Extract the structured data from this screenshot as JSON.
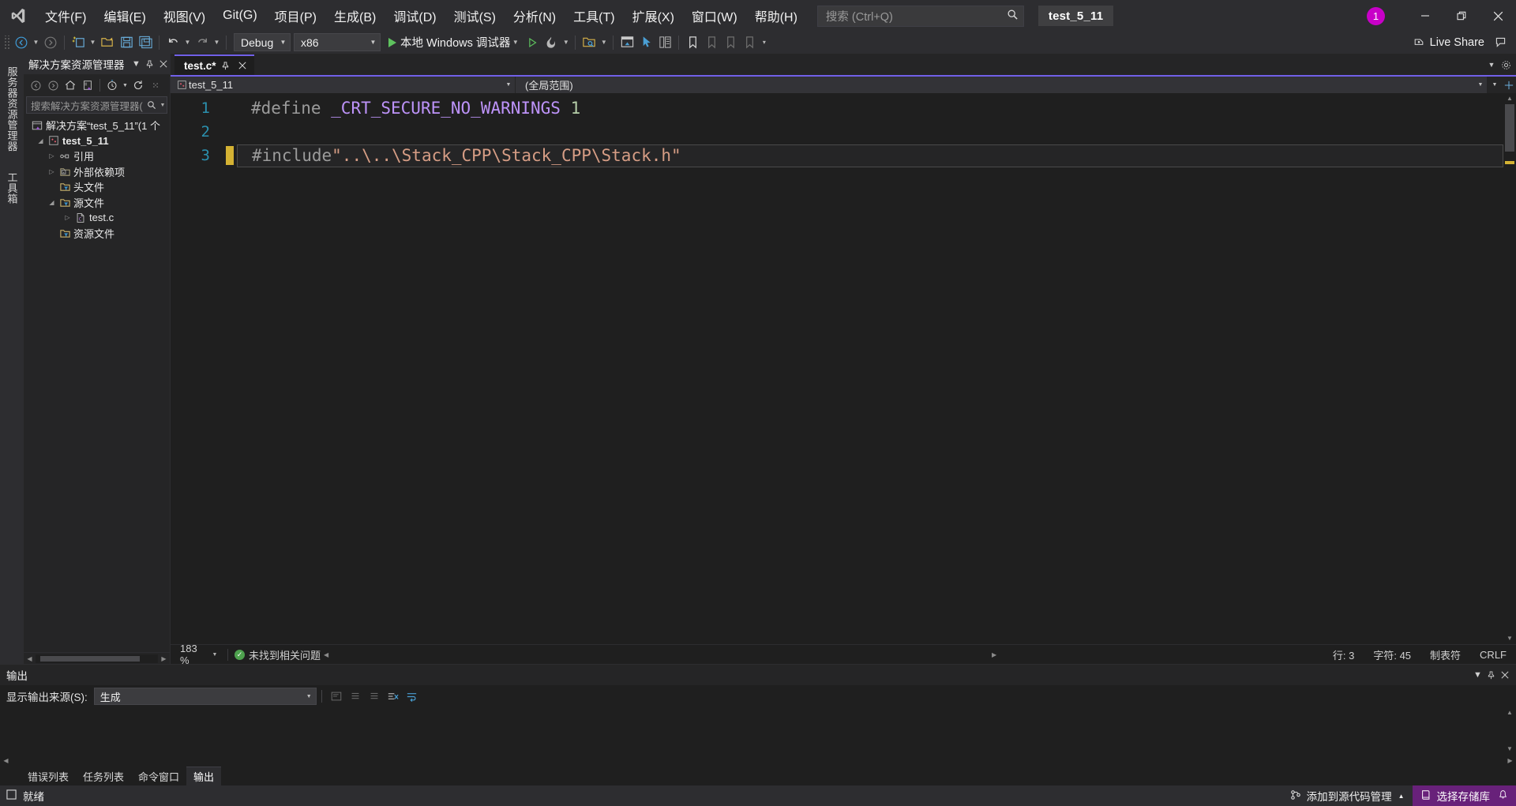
{
  "titlebar": {
    "logo_icon": "vs-logo-icon",
    "menus": [
      {
        "label": "文件(F)",
        "accel": "F"
      },
      {
        "label": "编辑(E)",
        "accel": "E"
      },
      {
        "label": "视图(V)",
        "accel": "V"
      },
      {
        "label": "Git(G)",
        "accel": "G"
      },
      {
        "label": "项目(P)",
        "accel": "P"
      },
      {
        "label": "生成(B)",
        "accel": "B"
      },
      {
        "label": "调试(D)",
        "accel": "D"
      },
      {
        "label": "测试(S)",
        "accel": "S"
      },
      {
        "label": "分析(N)",
        "accel": "N"
      },
      {
        "label": "工具(T)",
        "accel": "T"
      },
      {
        "label": "扩展(X)",
        "accel": "X"
      },
      {
        "label": "窗口(W)",
        "accel": "W"
      },
      {
        "label": "帮助(H)",
        "accel": "H"
      }
    ],
    "search_placeholder": "搜索 (Ctrl+Q)",
    "search_icon": "search-icon",
    "window_title": "test_5_11",
    "notification_count": "1",
    "notification_color": "#c800c8",
    "minimize_label": "—",
    "restore_label": "❐",
    "close_label": "✕"
  },
  "toolbar": {
    "nav_back_icon": "navigate-back-icon",
    "nav_forward_icon": "navigate-forward-icon",
    "new_project_icon": "new-project-icon",
    "open_file_icon": "open-file-icon",
    "save_icon": "save-icon",
    "save_all_icon": "save-all-icon",
    "undo_icon": "undo-icon",
    "redo_icon": "redo-icon",
    "config_value": "Debug",
    "platform_value": "x86",
    "run_label": "本地 Windows 调试器",
    "run_icon": "play-icon",
    "start_no_debug_icon": "play-outline-icon",
    "hot_reload_icon": "hot-reload-icon",
    "solution_explorer_icon": "solution-explorer-icon",
    "properties_window_icon": "properties-window-icon",
    "pointer_icon": "pointer-icon",
    "toolbox_icon": "toolbox-icon",
    "bookmark_icon": "bookmark-icon",
    "bm_prev_icon": "bookmark-prev-icon",
    "bm_next_icon": "bookmark-next-icon",
    "bm_clear_icon": "bookmark-clear-icon",
    "overflow_icon": "toolbar-overflow-icon",
    "live_share_label": "Live Share",
    "live_share_icon": "live-share-icon",
    "feedback_icon": "feedback-icon"
  },
  "vertical_tabs": [
    {
      "label": "服务器资源管理器"
    },
    {
      "label": "工具箱"
    }
  ],
  "solution_explorer": {
    "title": "解决方案资源管理器",
    "dropdown_icon": "chevron-down-icon",
    "pin_icon": "pin-icon",
    "close_icon": "close-icon",
    "toolbar": {
      "back_icon": "back-icon",
      "forward_icon": "forward-icon",
      "home_icon": "home-icon",
      "sync_icon": "sync-with-active-document-icon",
      "pending_changes_icon": "pending-changes-filter-icon",
      "refresh_icon": "refresh-icon",
      "collapse_icon": "collapse-all-icon",
      "show_all_icon": "show-all-files-icon",
      "properties_icon": "properties-icon",
      "more_icon": "more-icon"
    },
    "search_placeholder": "搜索解决方案资源管理器(",
    "search_icon": "search-icon",
    "tree": [
      {
        "label": "解决方案“test_5_11”(1 个",
        "icon": "solution-icon",
        "depth": 0,
        "chevron": "",
        "bold": false
      },
      {
        "label": "test_5_11",
        "icon": "cpp-project-icon",
        "depth": 1,
        "chevron": "expanded",
        "bold": true
      },
      {
        "label": "引用",
        "icon": "references-icon",
        "depth": 2,
        "chevron": "collapsed",
        "bold": false
      },
      {
        "label": "外部依赖项",
        "icon": "external-deps-icon",
        "depth": 2,
        "chevron": "collapsed",
        "bold": false
      },
      {
        "label": "头文件",
        "icon": "filter-folder-icon",
        "depth": 2,
        "chevron": "",
        "bold": false
      },
      {
        "label": "源文件",
        "icon": "filter-folder-icon",
        "depth": 2,
        "chevron": "expanded",
        "bold": false
      },
      {
        "label": "test.c",
        "icon": "c-file-icon",
        "depth": 3,
        "chevron": "collapsed",
        "bold": false
      },
      {
        "label": "资源文件",
        "icon": "filter-folder-icon",
        "depth": 2,
        "chevron": "",
        "bold": false
      }
    ]
  },
  "editor": {
    "tab_label": "test.c*",
    "tab_pin_icon": "pin-icon",
    "tab_close_icon": "close-icon",
    "tabstrip_chevron_icon": "chevron-down-icon",
    "tabstrip_config_icon": "gear-icon",
    "nav_project": "test_5_11",
    "nav_project_icon": "cpp-project-icon",
    "nav_scope": "(全局范围)",
    "nav_dropdown_icon": "chevron-down-icon",
    "code_lines": [
      {
        "number": "1",
        "changed": false,
        "current": false,
        "tokens": [
          {
            "text": "#define ",
            "cls": "tok-pre"
          },
          {
            "text": "_CRT_SECURE_NO_WARNINGS ",
            "cls": "tok-mac"
          },
          {
            "text": "1",
            "cls": "tok-num"
          }
        ]
      },
      {
        "number": "2",
        "changed": false,
        "current": false,
        "tokens": []
      },
      {
        "number": "3",
        "changed": true,
        "current": true,
        "tokens": [
          {
            "text": "#include ",
            "cls": "tok-pre"
          },
          {
            "text": "\"..\\..\\Stack_CPP\\Stack_CPP\\Stack.h\"",
            "cls": "tok-str"
          }
        ]
      }
    ],
    "status": {
      "zoom": "183 %",
      "zoom_arrow_icon": "chevron-down-icon",
      "issues_icon": "check-circle-icon",
      "issues_text": "未找到相关问题",
      "line_text": "行: 3",
      "col_text": "字符: 45",
      "tab_text": "制表符",
      "eol_text": "CRLF"
    }
  },
  "output": {
    "title": "输出",
    "dropdown_icon": "chevron-down-icon",
    "pin_icon": "pin-icon",
    "close_icon": "close-icon",
    "source_label": "显示输出来源(S):",
    "source_accel": "S",
    "source_value": "生成",
    "source_arrow_icon": "chevron-down-icon",
    "find_message_icon": "find-message-icon",
    "go_to_prev_icon": "go-to-previous-message-icon",
    "go_to_next_icon": "go-to-next-message-icon",
    "clear_all_icon": "clear-all-icon",
    "word_wrap_icon": "toggle-word-wrap-icon",
    "content": ""
  },
  "bottom_tabs": [
    {
      "label": "错误列表",
      "active": false
    },
    {
      "label": "任务列表",
      "active": false
    },
    {
      "label": "命令窗口",
      "active": false
    },
    {
      "label": "输出",
      "active": true
    }
  ],
  "statusbar": {
    "ready_text": "就绪",
    "ready_icon": "ready-icon",
    "add_source_control_label": "添加到源代码管理",
    "add_source_control_icon": "source-control-icon",
    "add_source_control_arrow": "chevron-up-icon",
    "repo_label": "选择存储库",
    "repo_icon": "repository-icon",
    "repo_color": "#68217a",
    "bell_icon": "bell-icon"
  },
  "colors": {
    "accent_purple": "#7160e8",
    "titlebar_bg": "#2d2d30",
    "editor_bg": "#1f1f1f",
    "panel_bg": "#252526",
    "line_number": "#2b91af",
    "string": "#d69d85",
    "macro": "#bd93f9",
    "number": "#b5cea8",
    "preproc": "#9b9b9b",
    "changed_marker": "#d4b233"
  }
}
